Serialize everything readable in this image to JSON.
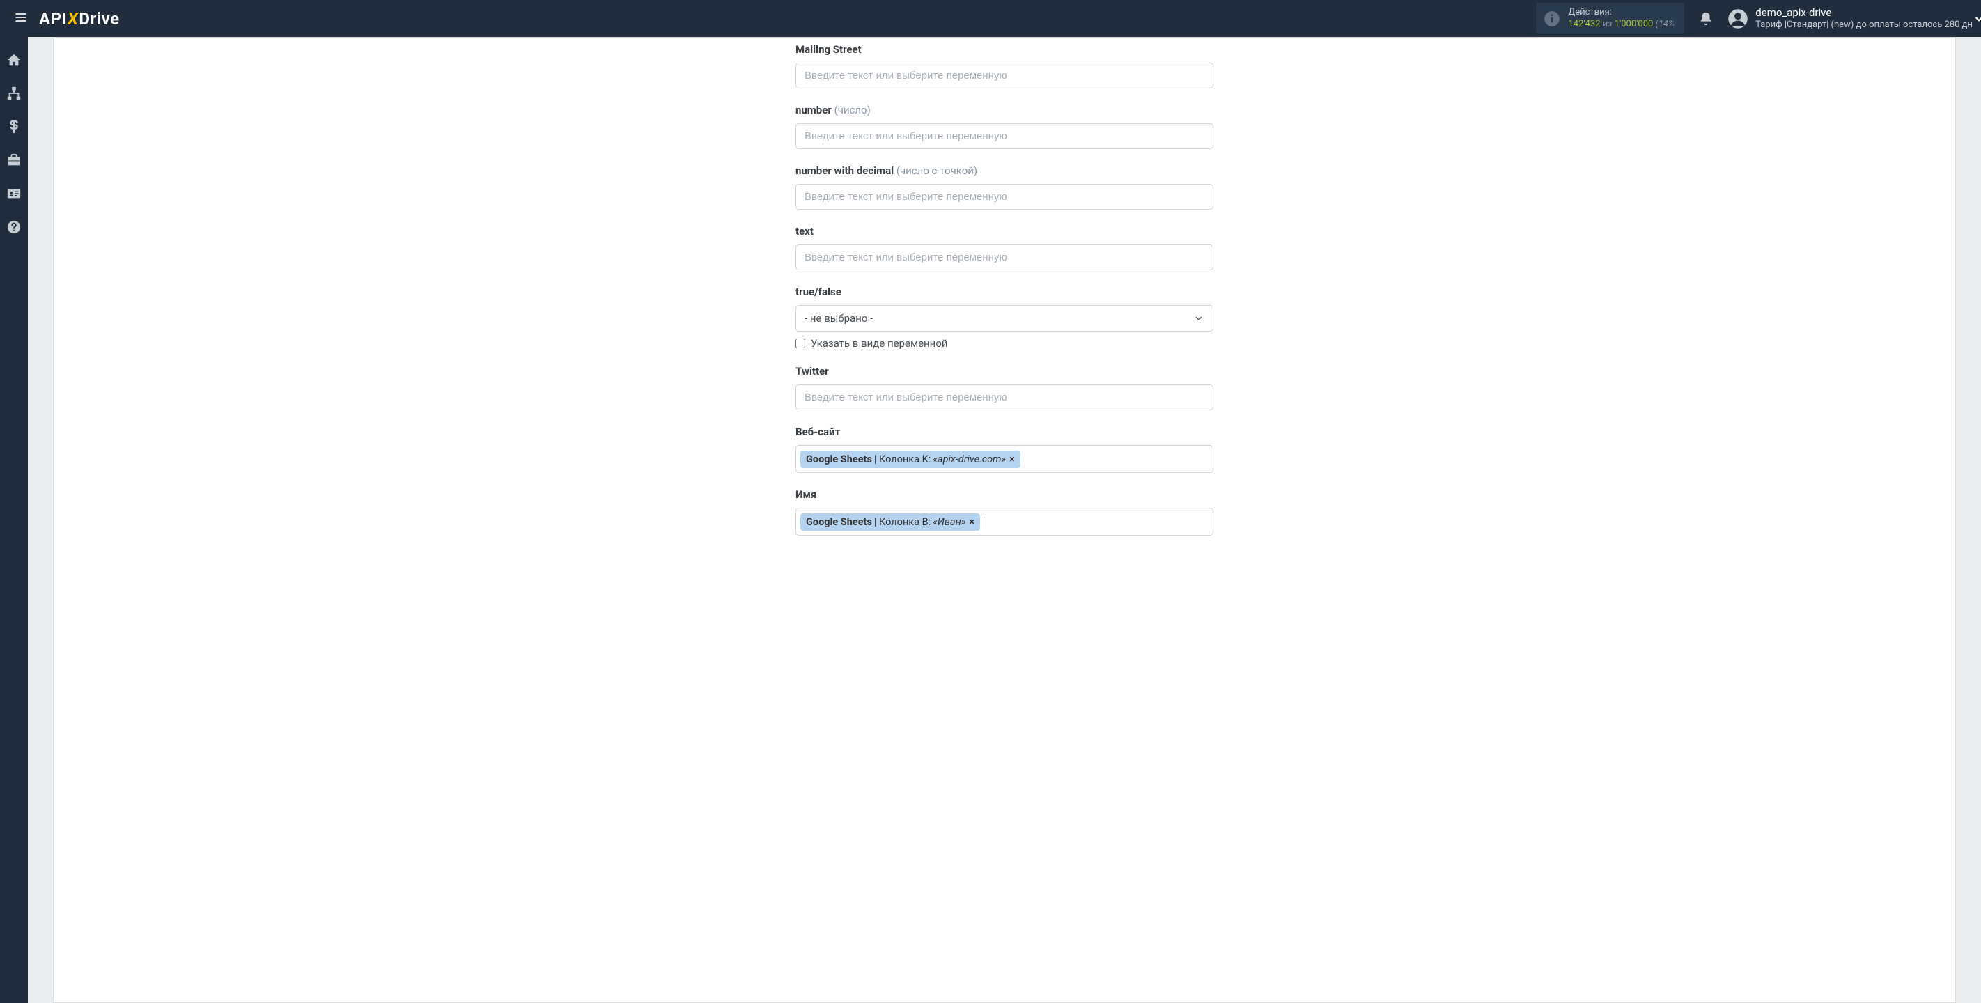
{
  "header": {
    "logo_prefix": "API",
    "logo_x": "X",
    "logo_suffix": "Drive",
    "actions_label": "Действия:",
    "actions_value": "142'432",
    "actions_of": " из ",
    "actions_total": "1'000'000",
    "actions_pct": " (14%",
    "user_name": "demo_apix-drive",
    "user_tariff": "Тариф |Стандарт| (new) до оплаты осталось 280 дн"
  },
  "form": {
    "placeholder": "Введите текст или выберите переменную",
    "fields": {
      "mailing_street": {
        "label": "Mailing Street"
      },
      "number": {
        "label": "number",
        "hint": "(число)"
      },
      "number_decimal": {
        "label": "number with decimal",
        "hint": "(число с точкой)"
      },
      "text": {
        "label": "text"
      },
      "truefalse": {
        "label": "true/false",
        "selected": "- не выбрано -",
        "checkbox_label": "Указать в виде переменной"
      },
      "twitter": {
        "label": "Twitter"
      },
      "website": {
        "label": "Веб-сайт",
        "tag_source": "Google Sheets",
        "tag_rest": " | Колонка K: ",
        "tag_value": "«apix-drive.com»"
      },
      "name": {
        "label": "Имя",
        "tag_source": "Google Sheets",
        "tag_rest": " | Колонка B: ",
        "tag_value": "«Иван»"
      }
    }
  }
}
